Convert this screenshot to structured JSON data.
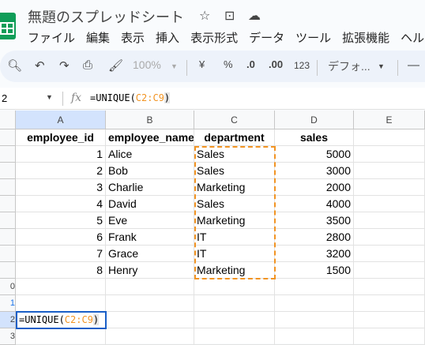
{
  "app": {
    "title": "無題のスプレッドシート",
    "icons": [
      "star-icon",
      "move-folder-icon",
      "cloud-saved-icon"
    ]
  },
  "menu": [
    "ファイル",
    "編集",
    "表示",
    "挿入",
    "表示形式",
    "データ",
    "ツール",
    "拡張機能",
    "ヘルプ"
  ],
  "toolbar": {
    "zoom": "100%",
    "currency": "¥",
    "percent": "%",
    "dec_decrease": ".0",
    "dec_increase": ".00",
    "number_format": "123",
    "font": "デフォ..."
  },
  "formula_bar": {
    "cell_ref": "2",
    "fx": "fx",
    "formula_prefix": "=UNIQUE(",
    "formula_range": "C2:C9",
    "formula_suffix": ")"
  },
  "columns": [
    "A",
    "B",
    "C",
    "D",
    "E"
  ],
  "rows": [
    [
      "employee_id",
      "employee_name",
      "department",
      "sales"
    ],
    [
      "1",
      "Alice",
      "Sales",
      "5000"
    ],
    [
      "2",
      "Bob",
      "Sales",
      "3000"
    ],
    [
      "3",
      "Charlie",
      "Marketing",
      "2000"
    ],
    [
      "4",
      "David",
      "Sales",
      "4000"
    ],
    [
      "5",
      "Eve",
      "Marketing",
      "3500"
    ],
    [
      "6",
      "Frank",
      "IT",
      "2800"
    ],
    [
      "7",
      "Grace",
      "IT",
      "3200"
    ],
    [
      "8",
      "Henry",
      "Marketing",
      "1500"
    ]
  ],
  "row_labels": [
    "0",
    "1",
    "2",
    "3"
  ],
  "active_cell": {
    "prefix": "=UNIQUE(",
    "range": "C2:C9",
    "suffix": ")"
  },
  "colors": {
    "accent": "#1a73e8",
    "range": "#f6b26b",
    "range_border": "#f29423"
  }
}
